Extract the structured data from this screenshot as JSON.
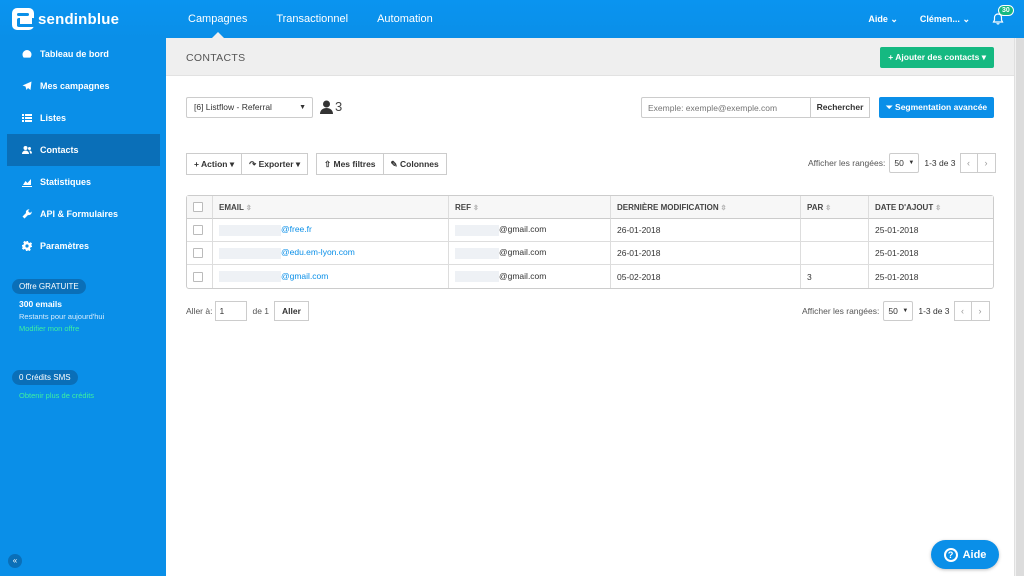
{
  "brand": {
    "name": "sendinblue"
  },
  "topnav": [
    {
      "label": "Campagnes"
    },
    {
      "label": "Transactionnel"
    },
    {
      "label": "Automation"
    }
  ],
  "topright": {
    "help": "Aide",
    "user": "Clémen...",
    "notif_count": "30"
  },
  "sidebar": {
    "items": [
      {
        "label": "Tableau de bord",
        "icon": "dashboard-icon"
      },
      {
        "label": "Mes campagnes",
        "icon": "paper-plane-icon"
      },
      {
        "label": "Listes",
        "icon": "list-icon"
      },
      {
        "label": "Contacts",
        "icon": "users-icon"
      },
      {
        "label": "Statistiques",
        "icon": "chart-icon"
      },
      {
        "label": "API & Formulaires",
        "icon": "wrench-icon"
      },
      {
        "label": "Paramètres",
        "icon": "gear-icon"
      }
    ],
    "offer": {
      "badge": "Offre GRATUITE",
      "emails": "300 emails",
      "remaining": "Restants pour aujourd'hui",
      "link": "Modifier mon offre"
    },
    "sms": {
      "badge": "0 Crédits SMS",
      "link": "Obtenir plus de crédits"
    },
    "collapse": "«"
  },
  "page": {
    "title": "CONTACTS",
    "add_button": "+ Ajouter des contacts ▾",
    "list_select": "[6] Listflow - Referral",
    "contact_count": "3",
    "search_placeholder": "Exemple: exemple@exemple.com",
    "search_button": "Rechercher",
    "segment_button": "Segmentation avancée"
  },
  "toolbar": {
    "action": "+ Action ▾",
    "export": "↷ Exporter ▾",
    "filters": "⇧ Mes filtres",
    "columns": "✎ Colonnes",
    "rows_label": "Afficher les rangées:",
    "rows_value": "50",
    "range": "1-3 de 3",
    "prev": "‹",
    "next": "›"
  },
  "table": {
    "headers": [
      "EMAIL",
      "REF",
      "DERNIÈRE MODIFICATION",
      "PAR",
      "DATE D'AJOUT"
    ],
    "rows": [
      {
        "email_domain": "@free.fr",
        "ref": "@gmail.com",
        "modified": "26-01-2018",
        "par": "",
        "added": "25-01-2018"
      },
      {
        "email_domain": "@edu.em-lyon.com",
        "ref": "@gmail.com",
        "modified": "26-01-2018",
        "par": "",
        "added": "25-01-2018"
      },
      {
        "email_domain": "@gmail.com",
        "ref": "@gmail.com",
        "modified": "05-02-2018",
        "par": "3",
        "added": "25-01-2018"
      }
    ]
  },
  "footer": {
    "goto_label": "Aller à:",
    "goto_value": "1",
    "of_label": "de 1",
    "go_button": "Aller",
    "rows_label": "Afficher les rangées:",
    "rows_value": "50",
    "range": "1-3 de 3"
  },
  "help_widget": {
    "label": "Aide"
  }
}
